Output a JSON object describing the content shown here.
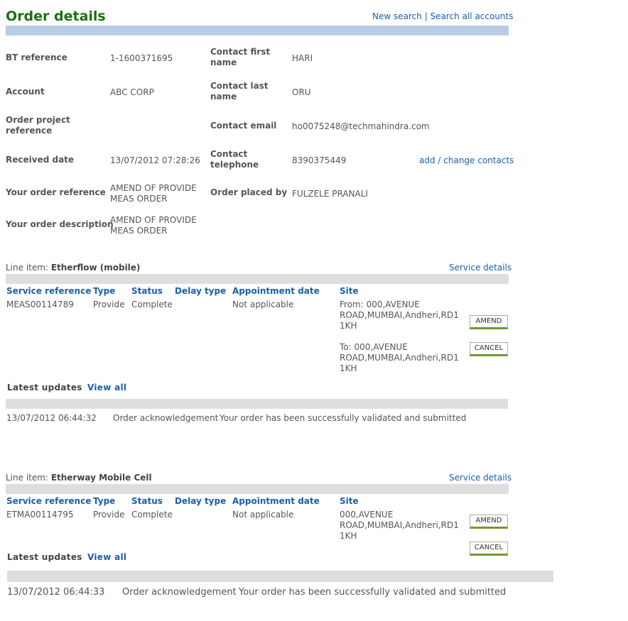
{
  "header": {
    "title": "Order details",
    "new_search": "New search",
    "separator": "|",
    "search_all": "Search all accounts"
  },
  "order": {
    "bt_reference_label": "BT reference",
    "bt_reference": "1-1600371695",
    "account_label": "Account",
    "account": "ABC CORP",
    "project_ref_label_1": "Order project",
    "project_ref_label_2": "reference",
    "project_ref": "",
    "received_label": "Received date",
    "received": "13/07/2012 07:28:26",
    "your_ref_label": "Your order reference",
    "your_ref_1": "AMEND OF PROVIDE",
    "your_ref_2": "MEAS ORDER",
    "your_desc_label": "Your order description",
    "your_desc_1": "AMEND OF PROVIDE",
    "your_desc_2": "MEAS ORDER",
    "contact_first_label_1": "Contact first",
    "contact_first_label_2": "name",
    "contact_first": "HARI",
    "contact_last_label_1": "Contact last",
    "contact_last_label_2": "name",
    "contact_last": "ORU",
    "contact_email_label": "Contact email",
    "contact_email": "ho0075248@techmahindra.com",
    "contact_tel_label_1": "Contact",
    "contact_tel_label_2": "telephone",
    "contact_tel": "8390375449",
    "change_contacts": "add / change contacts",
    "placed_by_label": "Order placed by",
    "placed_by": "FULZELE PRANALI"
  },
  "columns": {
    "service_ref": "Service reference",
    "type": "Type",
    "status": "Status",
    "delay": "Delay type",
    "appointment": "Appointment date",
    "site": "Site"
  },
  "line_items": [
    {
      "prefix": "Line item:",
      "name": "Etherflow (mobile)",
      "service_details": "Service details",
      "service_ref": "MEAS00114789",
      "type": "Provide",
      "status": "Complete",
      "appointment": "Not applicable",
      "site_from_1": "From: 000,AVENUE",
      "site_from_2": "ROAD,MUMBAI,Andheri,RD1",
      "site_from_3": "1KH",
      "site_to_1": "To: 000,AVENUE",
      "site_to_2": "ROAD,MUMBAI,Andheri,RD1",
      "site_to_3": "1KH",
      "amend": "AMEND",
      "cancel": "CANCEL",
      "latest_updates": "Latest updates",
      "view_all": "View all",
      "update_date": "13/07/2012 06:44:32",
      "update_type": "Order acknowledgement",
      "update_text": "Your order has been successfully validated and submitted"
    },
    {
      "prefix": "Line item:",
      "name": "Etherway Mobile Cell",
      "service_details": "Service details",
      "service_ref": "ETMA00114795",
      "type": "Provide",
      "status": "Complete",
      "appointment": "Not applicable",
      "site_1": "000,AVENUE",
      "site_2": "ROAD,MUMBAI,Andheri,RD1",
      "site_3": "1KH",
      "amend": "AMEND",
      "cancel": "CANCEL",
      "latest_updates": "Latest updates",
      "view_all": "View all",
      "update_date": "13/07/2012 06:44:33",
      "update_type": "Order acknowledgement",
      "update_text": "Your order has been successfully validated and submitted"
    }
  ]
}
